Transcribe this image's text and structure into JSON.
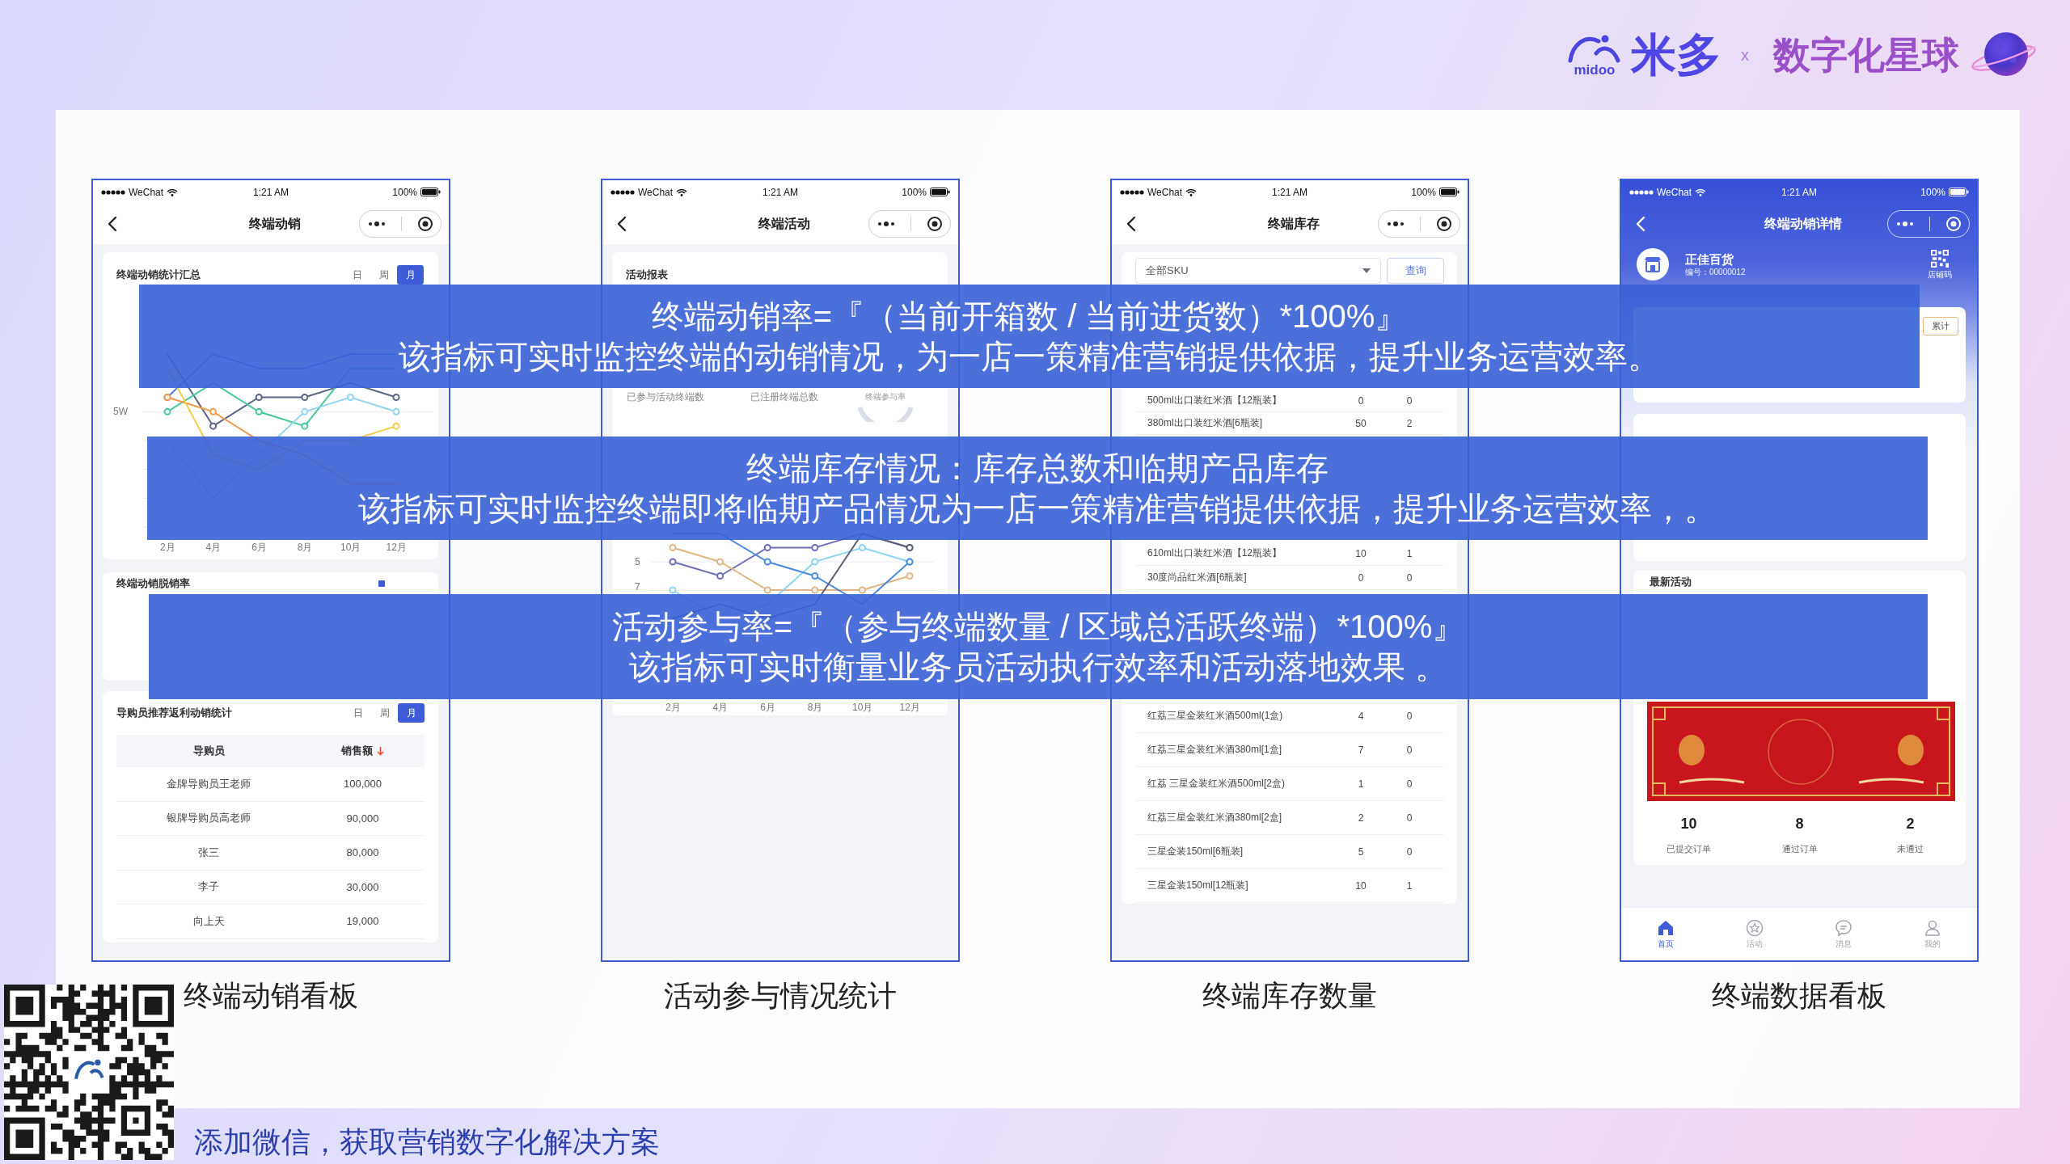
{
  "header": {
    "logo_text": "midoo",
    "brand": "米多",
    "separator": "x",
    "partner": "数字化星球"
  },
  "bands": [
    {
      "heading": "终端动销率=『（当前开箱数 / 当前进货数）*100%』",
      "description": "该指标可实时监控终端的动销情况，为一店一策精准营销提供依据，提升业务运营效率。"
    },
    {
      "heading": "终端库存情况：库存总数和临期产品库存",
      "description": "该指标可实时监控终端即将临期产品情况为一店一策精准营销提供依据，提升业务运营效率，。"
    },
    {
      "heading": "活动参与率=『（参与终端数量 / 区域总活跃终端）*100%』",
      "description": "该指标可实时衡量业务员活动执行效率和活动落地效果 。"
    }
  ],
  "phones": [
    {
      "kind": "sales",
      "status_bar": {
        "carrier": "WeChat",
        "time": "1:21 AM",
        "battery": "100%"
      },
      "title": "终端动销",
      "caption": "终端动销看板",
      "summary": {
        "title": "终端动销统计汇总",
        "periods": [
          {
            "label": "日",
            "selected": false
          },
          {
            "label": "周",
            "selected": false
          },
          {
            "label": "月",
            "selected": true
          }
        ],
        "y_labels": [
          "5W"
        ],
        "x_labels": [
          "2月",
          "4月",
          "6月",
          "8月",
          "10月",
          "12月"
        ]
      },
      "stockout": {
        "title": "终端动销脱销率"
      },
      "ranking": {
        "title": "导购员推荐返利动销统计",
        "periods": [
          {
            "label": "日",
            "selected": false
          },
          {
            "label": "周",
            "selected": false
          },
          {
            "label": "月",
            "selected": true
          }
        ],
        "columns": [
          {
            "label": "导购员",
            "sorted": false
          },
          {
            "label": "销售额",
            "sorted": true
          }
        ],
        "rows": [
          {
            "name": "金牌导购员王老师",
            "amount": "100,000"
          },
          {
            "name": "银牌导购员高老师",
            "amount": "90,000"
          },
          {
            "name": "张三",
            "amount": "80,000"
          },
          {
            "name": "李子",
            "amount": "30,000"
          },
          {
            "name": "向上天",
            "amount": "19,000"
          }
        ]
      }
    },
    {
      "kind": "activity",
      "status_bar": {
        "carrier": "WeChat",
        "time": "1:21 AM",
        "battery": "100%"
      },
      "title": "终端活动",
      "caption": "活动参与情况统计",
      "report": {
        "title": "活动报表",
        "stat_labels": [
          "已参与活动终端数",
          "已注册终端总数"
        ],
        "ring_label": "终端参与率",
        "y_labels": [
          "5",
          "7"
        ],
        "x_labels": [
          "2月",
          "4月",
          "6月",
          "8月",
          "10月",
          "12月"
        ]
      }
    },
    {
      "kind": "stock",
      "status_bar": {
        "carrier": "WeChat",
        "time": "1:21 AM",
        "battery": "100%"
      },
      "title": "终端库存",
      "caption": "终端库存数量",
      "filter": {
        "value": "全部SKU"
      },
      "query_button": "查询",
      "row_groups": [
        [
          {
            "name": "500ml出口装红米酒【12瓶装】",
            "stock": "0",
            "expiring": "0"
          },
          {
            "name": "380ml出口装红米酒[6瓶装]",
            "stock": "50",
            "expiring": "2"
          }
        ],
        [
          {
            "name": "610ml出口装红米酒【12瓶装】",
            "stock": "10",
            "expiring": "1"
          },
          {
            "name": "30度尚品红米酒[6瓶装]",
            "stock": "0",
            "expiring": "0"
          }
        ],
        [
          {
            "name": "红荔三星金装红米酒500ml(1盒)",
            "stock": "4",
            "expiring": "0"
          },
          {
            "name": "红荔三星金装红米酒380ml[1盒]",
            "stock": "7",
            "expiring": "0"
          },
          {
            "name": "红荔 三星金装红米酒500ml[2盒)",
            "stock": "1",
            "expiring": "0"
          },
          {
            "name": "红荔三星金装红米酒380ml[2盒]",
            "stock": "2",
            "expiring": "0"
          },
          {
            "name": "三星金装150ml[6瓶装]",
            "stock": "5",
            "expiring": "0"
          },
          {
            "name": "三星金装150ml[12瓶装]",
            "stock": "10",
            "expiring": "1"
          }
        ]
      ]
    },
    {
      "kind": "detail",
      "status_bar": {
        "carrier": "WeChat",
        "time": "1:21 AM",
        "battery": "100%"
      },
      "title": "终端动销详情",
      "caption": "终端数据看板",
      "store": {
        "name": "正佳百货",
        "number": "编号：00000012",
        "code_label": "店铺码"
      },
      "overview_tabs": [
        {
          "label": "累计",
          "selected": false
        }
      ],
      "activity": {
        "title": "最新活动",
        "stats": [
          {
            "value": "10",
            "label": "已提交订单"
          },
          {
            "value": "8",
            "label": "通过订单"
          },
          {
            "value": "2",
            "label": "未通过"
          }
        ]
      },
      "tab_bar": [
        {
          "label": "首页",
          "selected": true
        },
        {
          "label": "活动",
          "selected": false
        },
        {
          "label": "消息",
          "selected": false
        },
        {
          "label": "我的",
          "selected": false
        }
      ]
    }
  ],
  "footer": {
    "contact": "添加微信，获取营销数字化解决方案"
  }
}
